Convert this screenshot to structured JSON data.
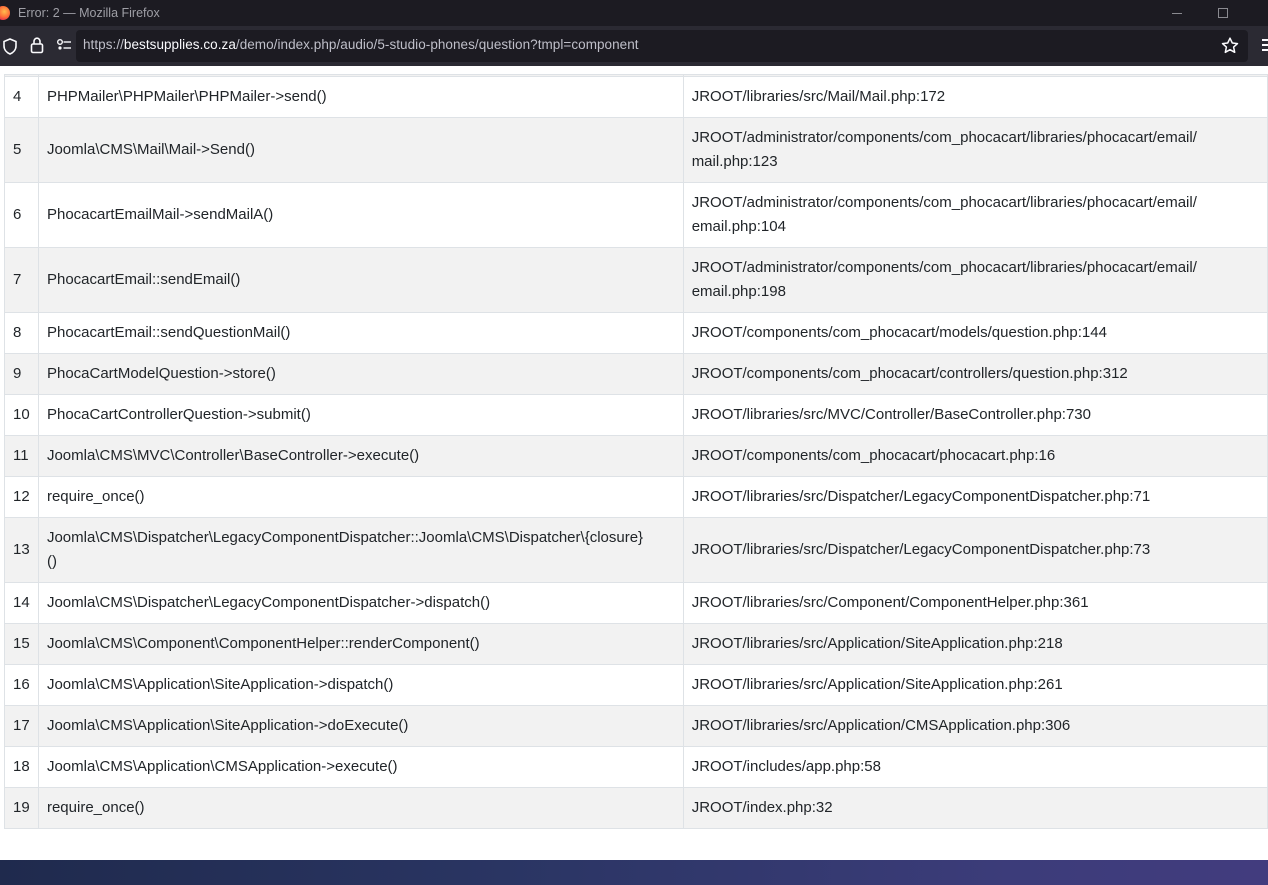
{
  "window": {
    "title": "Error: 2 — Mozilla Firefox"
  },
  "browser": {
    "url_scheme": "https://",
    "url_host": "bestsupplies.co.za",
    "url_path": "/demo/index.php/audio/5-studio-phones/question?tmpl=component"
  },
  "trace": {
    "rows": [
      {
        "num": "4",
        "function": "PHPMailer\\PHPMailer\\PHPMailer->send()",
        "location": "JROOT/libraries/src/Mail/Mail.php:172"
      },
      {
        "num": "5",
        "function": "Joomla\\CMS\\Mail\\Mail->Send()",
        "location": "JROOT/administrator/components/com_phocacart/libraries/phocacart/email/\nmail.php:123"
      },
      {
        "num": "6",
        "function": "PhocacartEmailMail->sendMailA()",
        "location": "JROOT/administrator/components/com_phocacart/libraries/phocacart/email/\nemail.php:104"
      },
      {
        "num": "7",
        "function": "PhocacartEmail::sendEmail()",
        "location": "JROOT/administrator/components/com_phocacart/libraries/phocacart/email/\nemail.php:198"
      },
      {
        "num": "8",
        "function": "PhocacartEmail::sendQuestionMail()",
        "location": "JROOT/components/com_phocacart/models/question.php:144"
      },
      {
        "num": "9",
        "function": "PhocaCartModelQuestion->store()",
        "location": "JROOT/components/com_phocacart/controllers/question.php:312"
      },
      {
        "num": "10",
        "function": "PhocaCartControllerQuestion->submit()",
        "location": "JROOT/libraries/src/MVC/Controller/BaseController.php:730"
      },
      {
        "num": "11",
        "function": "Joomla\\CMS\\MVC\\Controller\\BaseController->execute()",
        "location": "JROOT/components/com_phocacart/phocacart.php:16"
      },
      {
        "num": "12",
        "function": "require_once()",
        "location": "JROOT/libraries/src/Dispatcher/LegacyComponentDispatcher.php:71"
      },
      {
        "num": "13",
        "function": "Joomla\\CMS\\Dispatcher\\LegacyComponentDispatcher::Joomla\\CMS\\Dispatcher\\{closure}\n()",
        "location": "JROOT/libraries/src/Dispatcher/LegacyComponentDispatcher.php:73"
      },
      {
        "num": "14",
        "function": "Joomla\\CMS\\Dispatcher\\LegacyComponentDispatcher->dispatch()",
        "location": "JROOT/libraries/src/Component/ComponentHelper.php:361"
      },
      {
        "num": "15",
        "function": "Joomla\\CMS\\Component\\ComponentHelper::renderComponent()",
        "location": "JROOT/libraries/src/Application/SiteApplication.php:218"
      },
      {
        "num": "16",
        "function": "Joomla\\CMS\\Application\\SiteApplication->dispatch()",
        "location": "JROOT/libraries/src/Application/SiteApplication.php:261"
      },
      {
        "num": "17",
        "function": "Joomla\\CMS\\Application\\SiteApplication->doExecute()",
        "location": "JROOT/libraries/src/Application/CMSApplication.php:306"
      },
      {
        "num": "18",
        "function": "Joomla\\CMS\\Application\\CMSApplication->execute()",
        "location": "JROOT/includes/app.php:58"
      },
      {
        "num": "19",
        "function": "require_once()",
        "location": "JROOT/index.php:32"
      }
    ]
  },
  "icons": {
    "shield": "shield-icon",
    "lock": "lock-icon",
    "permissions": "permissions-icon",
    "bookmark": "star-icon",
    "menu": "hamburger-menu-icon"
  },
  "colors": {
    "titlebar": "#1c1b22",
    "navbar": "#2b2a33",
    "row_alt": "#f2f2f2",
    "footer": "#2a3563"
  }
}
